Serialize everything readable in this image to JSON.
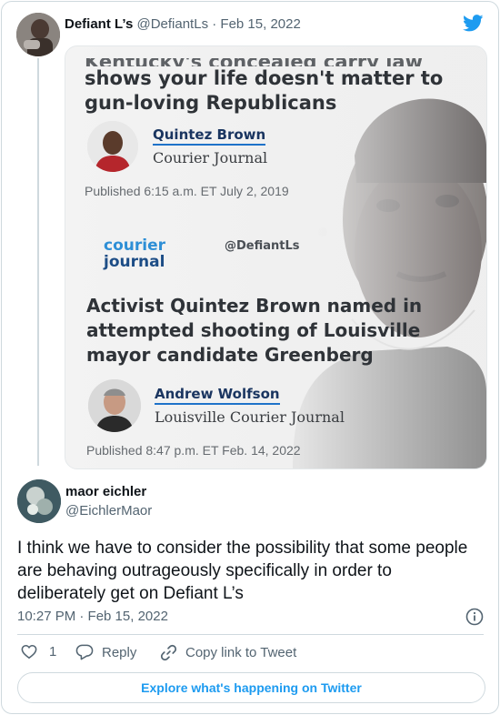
{
  "quoted": {
    "name": "Defiant L’s",
    "handle": "@DefiantLs",
    "date": "Feb 15, 2022"
  },
  "image": {
    "headline1_partial": "Kentucky's concealed carry law",
    "headline1": "shows your life doesn't matter to gun-loving Republicans",
    "author1": "Quintez Brown",
    "outlet1": "Courier Journal",
    "published1": "Published 6:15 a.m. ET July 2, 2019",
    "logo_line1": "courier",
    "logo_line2": "journal",
    "watermark": "@DefiantLs",
    "headline2": "Activist Quintez Brown named in attempted shooting of Louisville mayor candidate Greenberg",
    "author2": "Andrew Wolfson",
    "outlet2": "Louisville Courier Journal",
    "published2": "Published 8:47 p.m. ET Feb. 14, 2022"
  },
  "reply": {
    "name": "maor eichler",
    "handle": "@EichlerMaor",
    "text": "I think we have to consider the possibility that some people are behaving outrageously specifically in order to deliberately get on Defiant L’s",
    "timestamp": "10:27 PM · Feb 15, 2022"
  },
  "actions": {
    "like_count": "1",
    "reply_label": "Reply",
    "copy_label": "Copy link to Tweet"
  },
  "explore_label": "Explore what's happening on Twitter",
  "colors": {
    "accent": "#1d9bf0",
    "text": "#0f1419",
    "muted": "#536471",
    "border": "#cfd9de"
  },
  "icons": [
    "twitter-bird-icon",
    "info-icon",
    "heart-icon",
    "reply-bubble-icon",
    "link-icon"
  ]
}
